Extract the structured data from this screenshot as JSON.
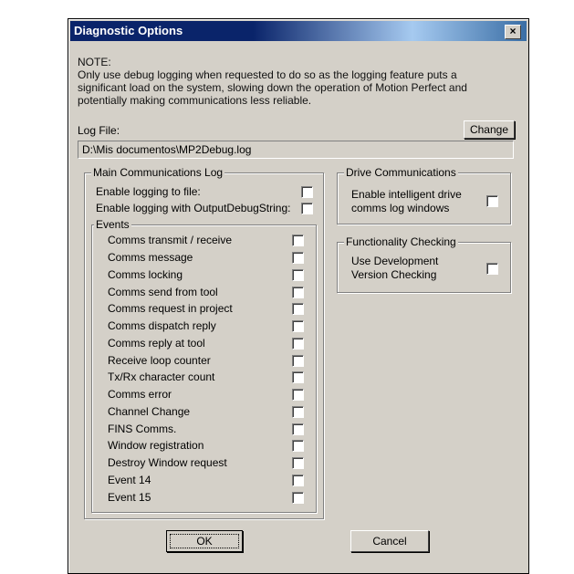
{
  "dialog": {
    "title": "Diagnostic Options",
    "close_glyph": "×",
    "note_heading": "NOTE:",
    "note_text": "Only use debug logging when requested to do so as the logging feature puts a significant load on the system, slowing down the operation of Motion Perfect and potentially making communications less reliable.",
    "log_file_label": "Log File:",
    "log_file_value": "D:\\Mis documentos\\MP2Debug.log",
    "change_label": "Change",
    "ok_label": "OK",
    "cancel_label": "Cancel"
  },
  "main_log": {
    "title": "Main Communications Log",
    "enable_file_label": "Enable logging to file:",
    "enable_debugstring_label": "Enable logging with OutputDebugString:"
  },
  "events": {
    "title": "Events",
    "items": [
      "Comms transmit / receive",
      "Comms message",
      "Comms locking",
      "Comms send from tool",
      "Comms request in project",
      "Comms dispatch reply",
      "Comms reply at tool",
      "Receive loop counter",
      "Tx/Rx character count",
      "Comms error",
      "Channel Change",
      "FINS Comms.",
      "Window registration",
      "Destroy Window request",
      "Event 14",
      "Event 15"
    ]
  },
  "drive": {
    "title": "Drive Communications",
    "label_line1": "Enable intelligent drive",
    "label_line2": "comms log windows"
  },
  "functionality": {
    "title": "Functionality Checking",
    "label_line1": "Use Development",
    "label_line2": "Version Checking"
  },
  "colors": {
    "face": "#d4d0c8",
    "title_dark": "#0a246a",
    "title_light": "#a6caf0"
  }
}
